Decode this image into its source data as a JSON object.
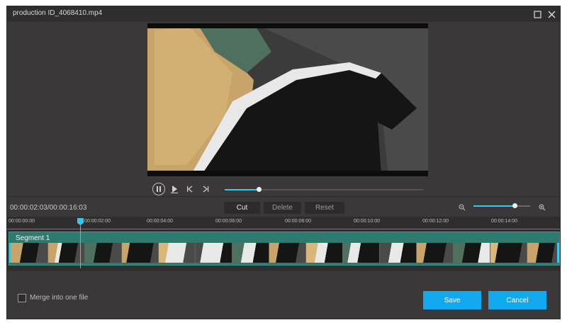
{
  "window": {
    "title": "production ID_4068410.mp4"
  },
  "icons": {
    "maximize": "maximize-icon",
    "close": "close-icon",
    "pause": "pause-icon",
    "play_from": "play-icon",
    "prev_frame": "skip-back-icon",
    "next_frame": "skip-forward-icon",
    "zoom_out": "zoom-out-icon",
    "zoom_in": "zoom-in-icon"
  },
  "player": {
    "progress_fraction": 0.13,
    "timecode": "00:00:02:03/00:00:16:03"
  },
  "edit": {
    "cut": "Cut",
    "delete": "Delete",
    "reset": "Reset"
  },
  "zoom": {
    "level_fraction": 0.73
  },
  "ruler": {
    "labels": [
      "00:00:00:00",
      "00:00:02:00",
      "00:00:04:00",
      "00:00:06:00",
      "00:00:08:00",
      "00:00:10:00",
      "00:00:12:00",
      "00:00:14:00"
    ]
  },
  "segment": {
    "label": "Segment 1"
  },
  "footer": {
    "merge_label": "Merge into one file",
    "merge_checked": false,
    "save": "Save",
    "cancel": "Cancel"
  },
  "colors": {
    "accent": "#35c9ef",
    "primary_button": "#12a9ef",
    "segment": "#2f7a6e",
    "window_bg": "#3a3839"
  }
}
